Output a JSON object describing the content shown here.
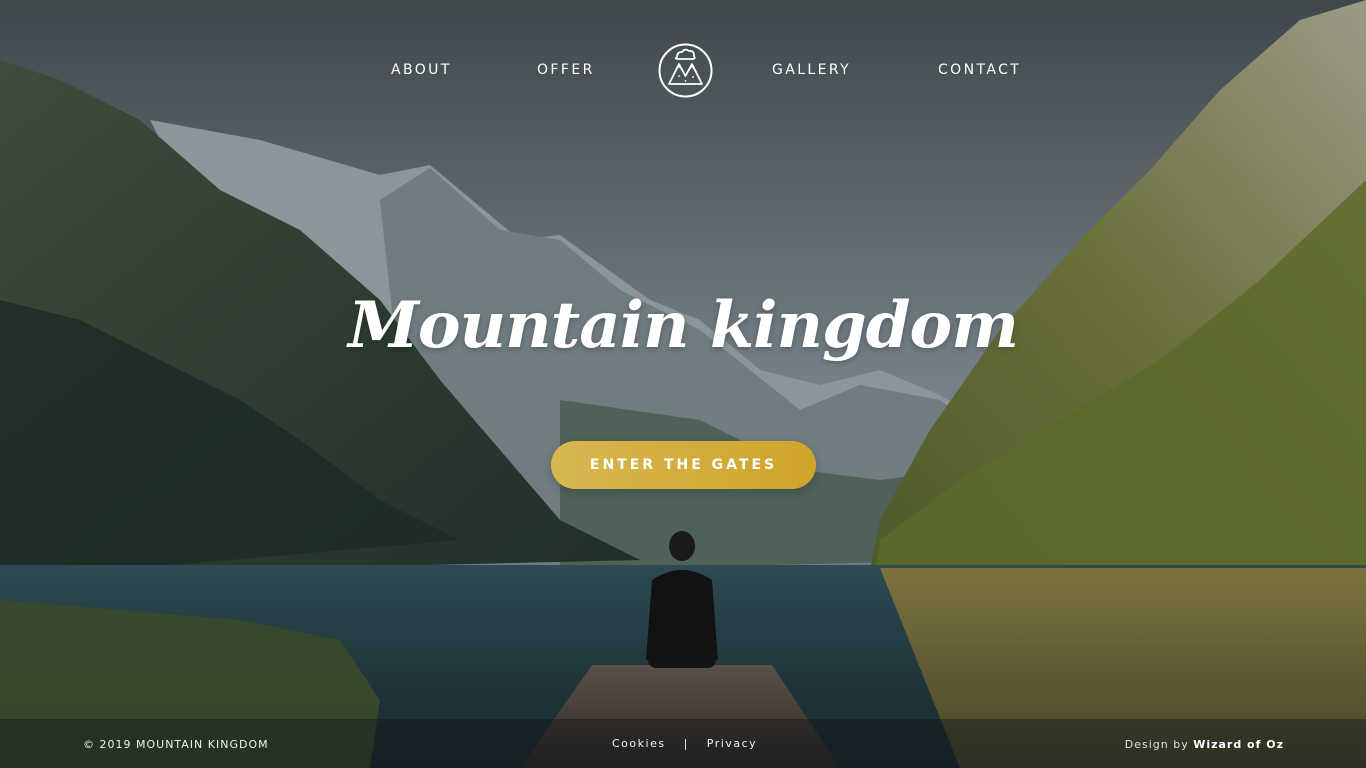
{
  "nav": {
    "about": "ABOUT",
    "offer": "OFFER",
    "gallery": "GALLERY",
    "contact": "CONTACT",
    "logo_icon": "mountain-logo-icon"
  },
  "hero": {
    "title": "Mountain kingdom",
    "cta_label": "ENTER THE GATES"
  },
  "footer": {
    "copyright": "© 2019 MOUNTAIN KINGDOM",
    "cookies": "Cookies",
    "separator": "|",
    "privacy": "Privacy",
    "credit_prefix": "Design by",
    "credit_name": "Wizard of Oz"
  },
  "colors": {
    "accent_gold": "#d4ad3b",
    "text": "#ffffff"
  }
}
